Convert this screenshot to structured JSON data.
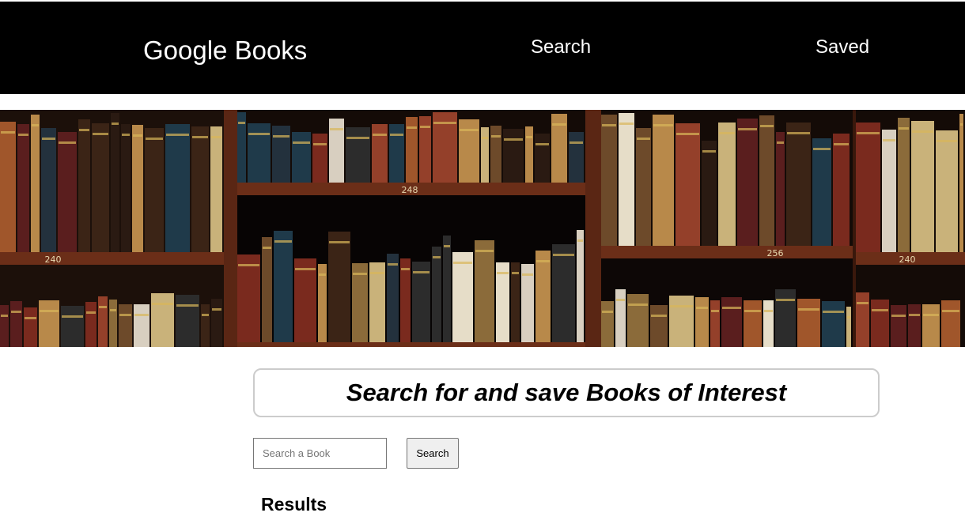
{
  "navbar": {
    "brand": "Google Books",
    "links": [
      {
        "label": "Search"
      },
      {
        "label": "Saved"
      }
    ]
  },
  "hero": {
    "image": "bookshelf-image",
    "shelf_numbers": [
      "240",
      "248",
      "256",
      "240"
    ]
  },
  "main": {
    "title": "Search for and save Books of Interest",
    "search": {
      "placeholder": "Search a Book",
      "value": "",
      "button_label": "Search"
    },
    "results_heading": "Results"
  }
}
